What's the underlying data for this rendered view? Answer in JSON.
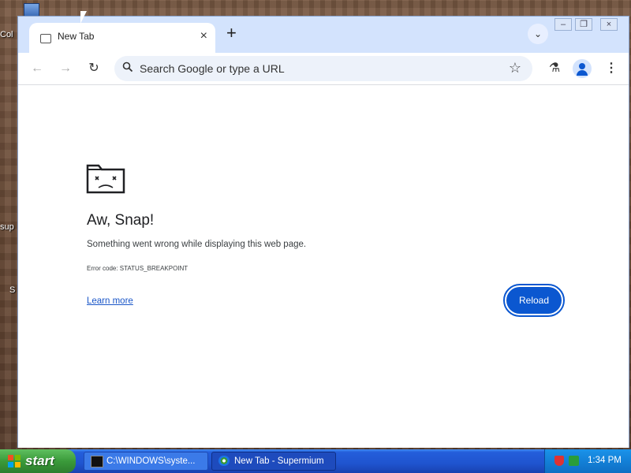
{
  "desktop": {
    "labels": [
      "Col",
      "sup",
      "S"
    ]
  },
  "browser": {
    "tab_title": "New Tab",
    "tab_close": "×",
    "new_tab": "+",
    "tab_search": "⌄",
    "window_controls": {
      "minimize": "–",
      "restore": "❐",
      "close": "×"
    },
    "toolbar": {
      "back": "←",
      "forward": "→",
      "reload": "↻",
      "omnibox_placeholder": "Search Google or type a URL",
      "labs": "⚗",
      "menu": "⋮"
    },
    "error_page": {
      "title": "Aw, Snap!",
      "description": "Something went wrong while displaying this web page.",
      "error_code": "Error code: STATUS_BREAKPOINT",
      "learn_more": "Learn more",
      "reload_label": "Reload"
    }
  },
  "taskbar": {
    "start_label": "start",
    "tasks": [
      {
        "label": "C:\\WINDOWS\\syste...",
        "active": false
      },
      {
        "label": "New Tab - Supermium",
        "active": true
      }
    ],
    "clock": "1:34 PM"
  },
  "colors": {
    "accent": "#0b57d0",
    "tabstrip": "#d3e3fd",
    "taskbar": "#245edb",
    "start": "#3a9a3a"
  }
}
